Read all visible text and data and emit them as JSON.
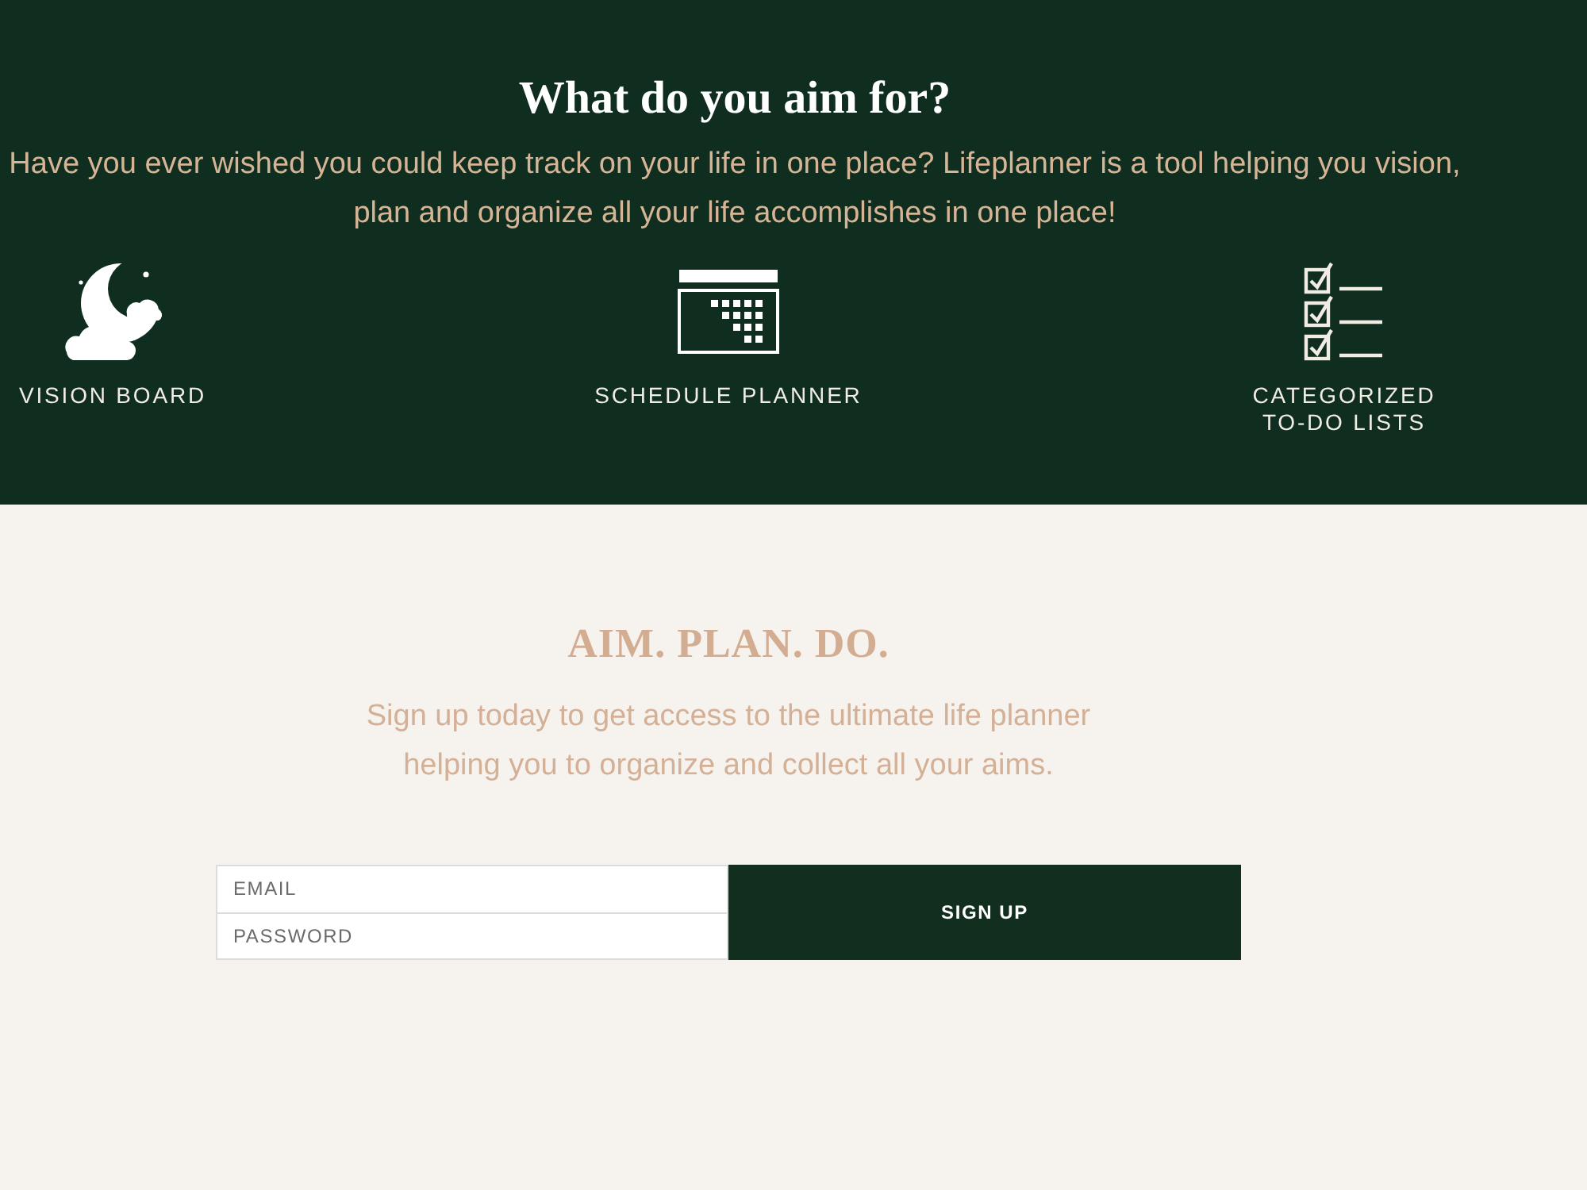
{
  "features_section": {
    "title": "What do you aim for?",
    "description": "Have you ever wished you could keep track on your life in one place? Lifeplanner is a tool helping you vision, plan and organize all your life accomplishes in one place!",
    "features": [
      {
        "kind": "moon",
        "label": "VISION BOARD"
      },
      {
        "kind": "calendar",
        "label": "SCHEDULE PLANNER"
      },
      {
        "kind": "checklist",
        "label": "CATEGORIZED TO-DO LISTS"
      }
    ]
  },
  "signup_section": {
    "heading": "AIM. PLAN. DO.",
    "description": "Sign up today to get access to the ultimate life planner helping you to organize and collect all your aims.",
    "fields": [
      {
        "placeholder": "EMAIL"
      },
      {
        "placeholder": "PASSWORD"
      }
    ],
    "button": "SIGN UP"
  }
}
